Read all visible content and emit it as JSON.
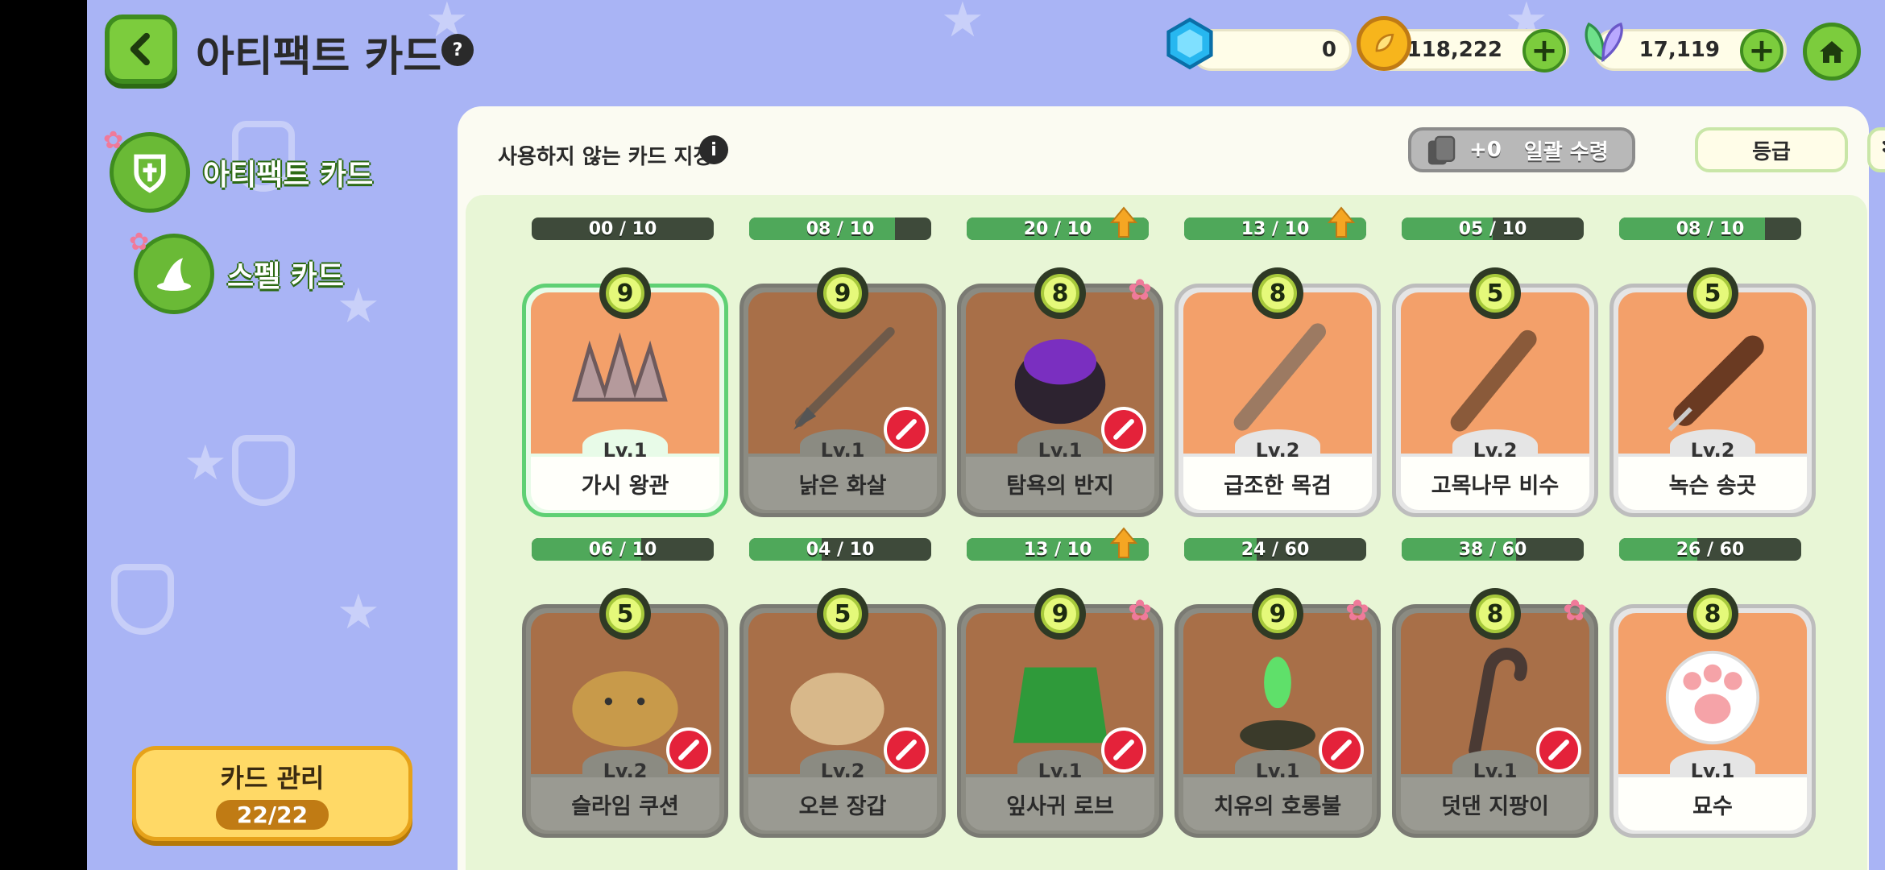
{
  "header": {
    "title": "아티팩트 카드",
    "help": "?"
  },
  "currencies": {
    "gems": "0",
    "coins": "118,222",
    "leaves": "17,119",
    "plus": "+"
  },
  "sidebar": {
    "tabs": [
      {
        "label": "아티팩트 카드"
      },
      {
        "label": "스펠 카드"
      }
    ],
    "manage": {
      "title": "카드 관리",
      "count": "22/22"
    }
  },
  "panel": {
    "unused_label": "사용하지 않는 카드 지정",
    "info": "i",
    "bulk": {
      "amount": "+0",
      "label": "일괄 수령"
    },
    "grade": "등급"
  },
  "cards": [
    {
      "progress": "00 / 10",
      "fill": 0.0,
      "upgrade": false,
      "cost": "9",
      "level": "Lv.1",
      "name": "가시 왕관",
      "banned": false,
      "flower": false,
      "style": "green"
    },
    {
      "progress": "08 / 10",
      "fill": 0.8,
      "upgrade": false,
      "cost": "9",
      "level": "Lv.1",
      "name": "낡은 화살",
      "banned": true,
      "flower": false,
      "style": "dim"
    },
    {
      "progress": "20 / 10",
      "fill": 1.0,
      "upgrade": true,
      "cost": "8",
      "level": "Lv.1",
      "name": "탐욕의 반지",
      "banned": true,
      "flower": true,
      "style": "dim"
    },
    {
      "progress": "13 / 10",
      "fill": 1.0,
      "upgrade": true,
      "cost": "8",
      "level": "Lv.2",
      "name": "급조한 목검",
      "banned": false,
      "flower": false,
      "style": "normal"
    },
    {
      "progress": "05 / 10",
      "fill": 0.5,
      "upgrade": false,
      "cost": "5",
      "level": "Lv.2",
      "name": "고목나무 비수",
      "banned": false,
      "flower": false,
      "style": "normal"
    },
    {
      "progress": "08 / 10",
      "fill": 0.8,
      "upgrade": false,
      "cost": "5",
      "level": "Lv.2",
      "name": "녹슨 송곳",
      "banned": false,
      "flower": false,
      "style": "normal"
    },
    {
      "progress": "06 / 10",
      "fill": 0.6,
      "upgrade": false,
      "cost": "5",
      "level": "Lv.2",
      "name": "슬라임 쿠션",
      "banned": true,
      "flower": false,
      "style": "dim"
    },
    {
      "progress": "04 / 10",
      "fill": 0.4,
      "upgrade": false,
      "cost": "5",
      "level": "Lv.2",
      "name": "오븐 장갑",
      "banned": true,
      "flower": false,
      "style": "dim"
    },
    {
      "progress": "13 / 10",
      "fill": 1.0,
      "upgrade": true,
      "cost": "9",
      "level": "Lv.1",
      "name": "잎사귀 로브",
      "banned": true,
      "flower": true,
      "style": "dim"
    },
    {
      "progress": "24 / 60",
      "fill": 0.4,
      "upgrade": false,
      "cost": "9",
      "level": "Lv.1",
      "name": "치유의 호롱불",
      "banned": true,
      "flower": true,
      "style": "dim"
    },
    {
      "progress": "38 / 60",
      "fill": 0.63,
      "upgrade": false,
      "cost": "8",
      "level": "Lv.1",
      "name": "덧댄 지팡이",
      "banned": true,
      "flower": true,
      "style": "dim"
    },
    {
      "progress": "26 / 60",
      "fill": 0.43,
      "upgrade": false,
      "cost": "8",
      "level": "Lv.1",
      "name": "묘수",
      "banned": false,
      "flower": false,
      "style": "normal"
    }
  ],
  "icons": {
    "back": "chevron-left-icon",
    "home": "home-icon",
    "gem": "gem-icon",
    "coin": "coin-icon",
    "leaf": "leaf-icon",
    "sort": "double-chevron-down-icon"
  }
}
